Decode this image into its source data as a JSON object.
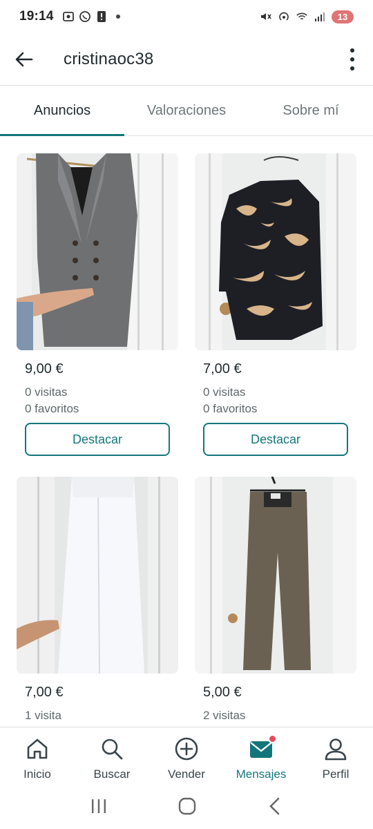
{
  "status_bar": {
    "time": "19:14",
    "battery_level": "13"
  },
  "header": {
    "username": "cristinaoc38"
  },
  "tabs": [
    {
      "label": "Anuncios",
      "active": true
    },
    {
      "label": "Valoraciones",
      "active": false
    },
    {
      "label": "Sobre mí",
      "active": false
    }
  ],
  "listings": [
    {
      "price": "9,00 €",
      "visits": "0 visitas",
      "favorites": "0 favoritos",
      "button": "Destacar",
      "image": "grey-sleeveless-vest-photo"
    },
    {
      "price": "7,00 €",
      "visits": "0 visitas",
      "favorites": "0 favoritos",
      "button": "Destacar",
      "image": "patterned-blouse-photo"
    },
    {
      "price": "7,00 €",
      "visits": "1 visita",
      "image": "white-pants-photo"
    },
    {
      "price": "5,00 €",
      "visits": "2 visitas",
      "image": "brown-trousers-photo"
    }
  ],
  "bottom_nav": [
    {
      "label": "Inicio",
      "icon": "home-icon"
    },
    {
      "label": "Buscar",
      "icon": "search-icon"
    },
    {
      "label": "Vender",
      "icon": "plus-circle-icon"
    },
    {
      "label": "Mensajes",
      "icon": "mail-icon",
      "active": true,
      "has_badge": true
    },
    {
      "label": "Perfil",
      "icon": "user-icon"
    }
  ],
  "colors": {
    "accent": "#13767b",
    "badge": "#e34b5c",
    "text": "#1f2a2e",
    "muted": "#5f686b"
  }
}
